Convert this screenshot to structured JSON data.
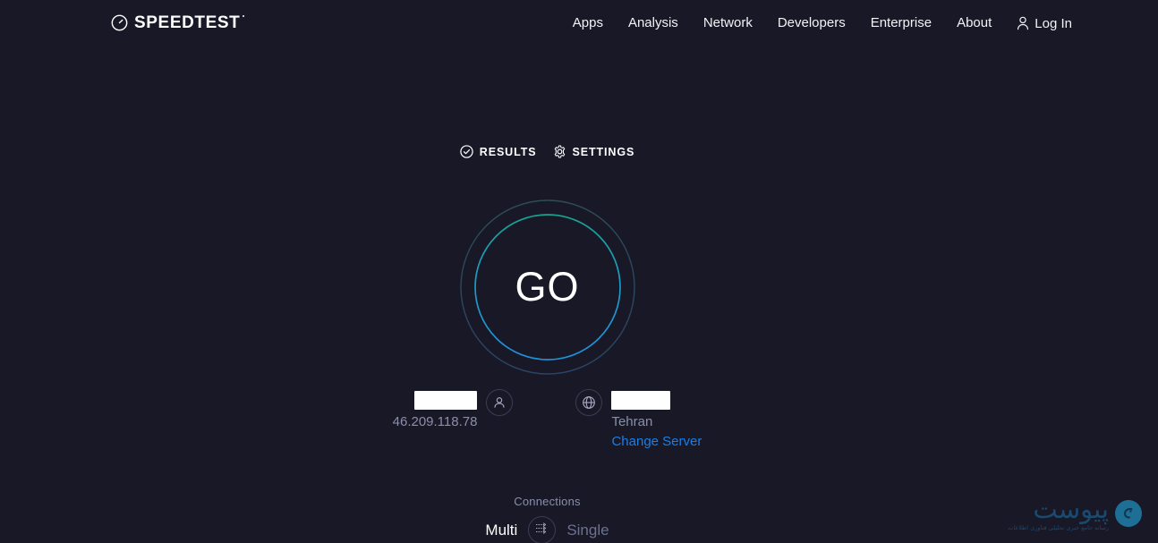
{
  "brand": {
    "name": "SPEEDTEST",
    "logo_icon": "speedometer-icon"
  },
  "nav": {
    "items": [
      {
        "label": "Apps"
      },
      {
        "label": "Analysis"
      },
      {
        "label": "Network"
      },
      {
        "label": "Developers"
      },
      {
        "label": "Enterprise"
      },
      {
        "label": "About"
      }
    ],
    "login": {
      "label": "Log In",
      "icon": "person-icon"
    }
  },
  "tools": [
    {
      "label": "RESULTS",
      "icon": "check-circle-icon"
    },
    {
      "label": "SETTINGS",
      "icon": "gear-icon"
    }
  ],
  "go_button": {
    "label": "GO",
    "ring_start_color": "#1aa08e",
    "ring_end_color": "#1f8fd8",
    "outer_ring_color": "#2a4a5e"
  },
  "connection": {
    "isp": {
      "name_redacted": true,
      "ip": "46.209.118.78",
      "icon": "person-icon"
    },
    "server": {
      "name_redacted": true,
      "location": "Tehran",
      "change_label": "Change Server",
      "change_color": "#1a7ee8",
      "icon": "globe-icon"
    }
  },
  "connections": {
    "title": "Connections",
    "multi_label": "Multi",
    "single_label": "Single",
    "selected": "Multi",
    "icon": "multi-arrows-icon"
  },
  "watermark": {
    "main_text": "پیوست",
    "sub_text": "رسانه جامع خبری تحلیلی فناوری اطلاعات",
    "color": "#1c4a6e",
    "badge_color": "#1e6f96",
    "badge_icon": "peyvast-mark-icon"
  },
  "theme": {
    "background": "#181827",
    "text_primary": "#ffffff",
    "text_muted": "#8a8fa8",
    "accent_link": "#1a7ee8"
  }
}
